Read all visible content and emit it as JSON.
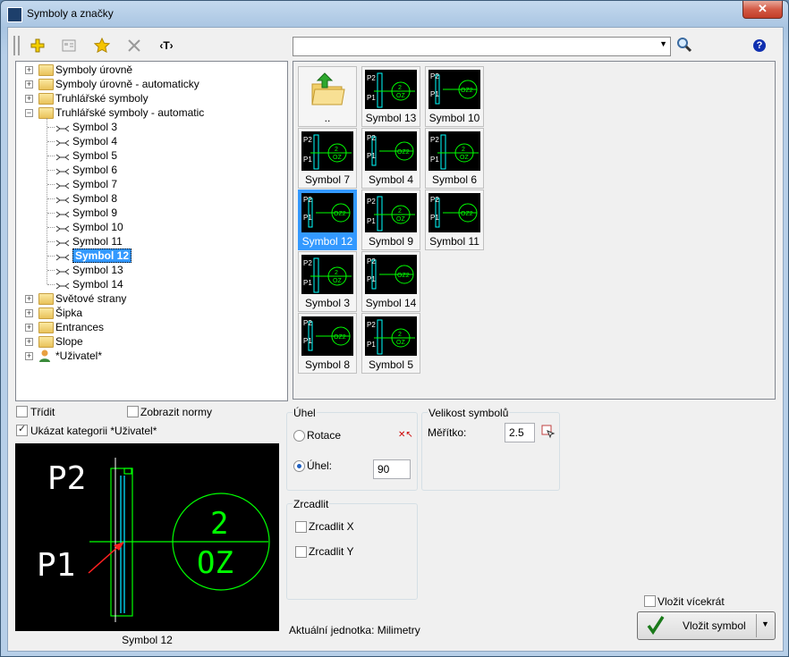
{
  "window": {
    "title": "Symboly a značky",
    "close_label": "✕"
  },
  "toolbar": {
    "add_icon": "add-icon",
    "edit_icon": "edit-icon",
    "favorite_icon": "star-icon",
    "delete_icon": "delete-icon",
    "text_tag": "‹T›"
  },
  "search": {
    "value": ""
  },
  "tree": [
    {
      "label": "Symboly úrovně",
      "type": "folder",
      "expander": "+"
    },
    {
      "label": "Symboly úrovně - automaticky",
      "type": "folder",
      "expander": "+"
    },
    {
      "label": "Truhlářské symboly",
      "type": "folder",
      "expander": "+"
    },
    {
      "label": "Truhlářské symboly - automatic",
      "type": "folder",
      "expander": "−"
    },
    {
      "label": "Symbol 3",
      "type": "leaf"
    },
    {
      "label": "Symbol 4",
      "type": "leaf"
    },
    {
      "label": "Symbol 5",
      "type": "leaf"
    },
    {
      "label": "Symbol 6",
      "type": "leaf"
    },
    {
      "label": "Symbol 7",
      "type": "leaf"
    },
    {
      "label": "Symbol 8",
      "type": "leaf"
    },
    {
      "label": "Symbol 9",
      "type": "leaf"
    },
    {
      "label": "Symbol 10",
      "type": "leaf"
    },
    {
      "label": "Symbol 11",
      "type": "leaf"
    },
    {
      "label": "Symbol 12",
      "type": "leaf",
      "selected": true
    },
    {
      "label": "Symbol 13",
      "type": "leaf"
    },
    {
      "label": "Symbol 14",
      "type": "leaf"
    },
    {
      "label": "Světové strany",
      "type": "folder",
      "expander": "+"
    },
    {
      "label": "Šipka",
      "type": "folder",
      "expander": "+"
    },
    {
      "label": "Entrances",
      "type": "folder",
      "expander": "+"
    },
    {
      "label": "Slope",
      "type": "folder",
      "expander": "+"
    },
    {
      "label": "*Uživatel*",
      "type": "user",
      "expander": "+"
    }
  ],
  "gallery": [
    {
      "label": "..",
      "kind": "up"
    },
    {
      "label": "Symbol 7"
    },
    {
      "label": "Symbol 12",
      "selected": true
    },
    {
      "label": "Symbol 3"
    },
    {
      "label": "Symbol 8"
    },
    {
      "label": "Symbol 13"
    },
    {
      "label": "Symbol 4"
    },
    {
      "label": "Symbol 9"
    },
    {
      "label": "Symbol 14"
    },
    {
      "label": "Symbol 5"
    },
    {
      "label": "Symbol 10"
    },
    {
      "label": "Symbol 6"
    },
    {
      "label": "Symbol 11"
    }
  ],
  "options": {
    "sort_label": "Třídit",
    "sort_checked": false,
    "norms_label": "Zobrazit normy",
    "norms_checked": false,
    "user_cat_label": "Ukázat kategorii *Uživatel*",
    "user_cat_checked": true
  },
  "preview": {
    "caption": "Symbol 12",
    "p2": "P2",
    "p1": "P1",
    "num": "2",
    "oz": "OZ"
  },
  "angle": {
    "group_label": "Úhel",
    "rotate_label": "Rotace",
    "angle_label": "Úhel:",
    "angle_value": "90",
    "selected": "angle"
  },
  "size": {
    "group_label": "Velikost symbolů",
    "scale_label": "Měřítko:",
    "scale_value": "2.5"
  },
  "mirror": {
    "group_label": "Zrcadlit",
    "x_label": "Zrcadlit X",
    "y_label": "Zrcadlit Y"
  },
  "units": {
    "text": "Aktuální jednotka: Milimetry"
  },
  "insert": {
    "multi_label": "Vložit vícekrát",
    "button_label": "Vložit symbol"
  },
  "colors": {
    "selection": "#3399ff",
    "cad_green": "#00ff00",
    "cad_cyan": "#00e0ff",
    "cad_red": "#ff2020"
  }
}
